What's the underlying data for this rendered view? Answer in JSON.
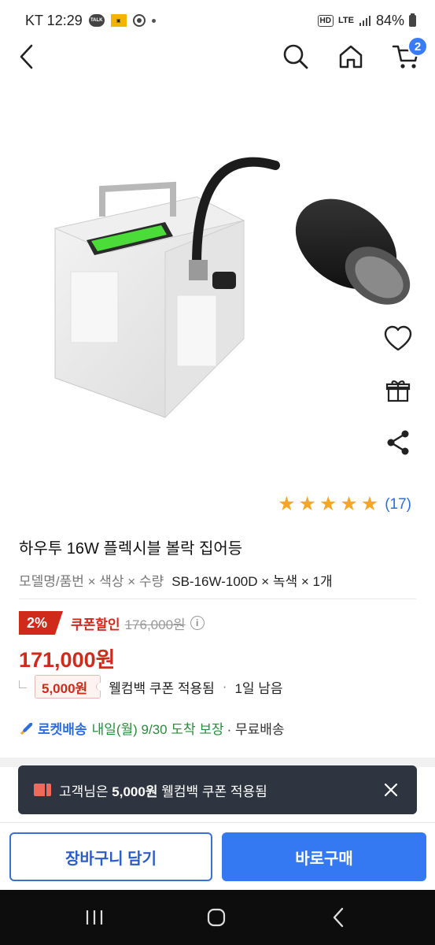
{
  "status_bar": {
    "carrier_time": "KT 12:29",
    "talk_label": "TALK",
    "hd_label": "HD",
    "lte_label": "LTE",
    "battery": "84%"
  },
  "header": {
    "cart_count": "2"
  },
  "product": {
    "rating_stars": 5,
    "review_count": "(17)",
    "title": "하우투 16W 플렉시블 볼락 집어등",
    "option_label": "모델명/품번 × 색상 × 수량",
    "option_value": "SB-16W-100D × 녹색 × 1개"
  },
  "price": {
    "discount_pct": "2%",
    "coupon_discount_label": "쿠폰할인",
    "original_price": "176,000원",
    "sale_price": "171,000원",
    "coupon_amount": "5,000원",
    "coupon_text": "웰컴백 쿠폰 적용됨",
    "coupon_separator": "·",
    "coupon_remaining": "1일 남음"
  },
  "delivery": {
    "rocket_label": "로켓배송",
    "arrival": "내일(월) 9/30 도착 보장",
    "free_shipping": "· 무료배송"
  },
  "toast": {
    "prefix": "고객님은",
    "amount": "5,000원",
    "suffix": "웰컴백 쿠폰 적용됨"
  },
  "actions": {
    "add_to_cart": "장바구니 담기",
    "buy_now": "바로구매"
  },
  "colors": {
    "accent_blue": "#3479f2",
    "price_red": "#cf2a1a",
    "star_gold": "#f5a623",
    "toast_bg": "#2e3540"
  }
}
